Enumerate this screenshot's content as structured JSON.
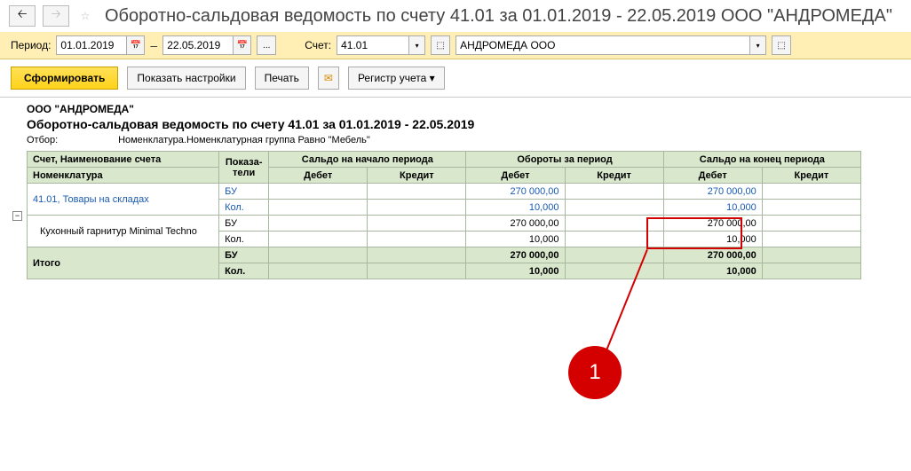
{
  "header": {
    "title": "Оборотно-сальдовая ведомость по счету 41.01 за 01.01.2019 - 22.05.2019 ООО \"АНДРОМЕДА\""
  },
  "filter": {
    "period_label": "Период:",
    "date_from": "01.01.2019",
    "date_to": "22.05.2019",
    "account_label": "Счет:",
    "account": "41.01",
    "org": "АНДРОМЕДА ООО",
    "more": "..."
  },
  "toolbar": {
    "generate": "Сформировать",
    "show_settings": "Показать настройки",
    "print": "Печать",
    "register": "Регистр учета"
  },
  "report": {
    "org_name": "ООО \"АНДРОМЕДА\"",
    "title": "Оборотно-сальдовая ведомость по счету 41.01 за 01.01.2019 - 22.05.2019",
    "selection_label": "Отбор:",
    "selection_value": "Номенклатура.Номенклатурная группа Равно \"Мебель\""
  },
  "grid": {
    "h_account": "Счет, Наименование счета",
    "h_nomen": "Номенклатура",
    "h_indicators": "Показа-\nтели",
    "h_start": "Сальдо на начало периода",
    "h_turn": "Обороты за период",
    "h_end": "Сальдо на конец периода",
    "h_debit": "Дебет",
    "h_credit": "Кредит",
    "row1_name": "41.01, Товары на складах",
    "row1_ind1": "БУ",
    "row1_ind2": "Кол.",
    "row1_turn_d1": "270 000,00",
    "row1_turn_d2": "10,000",
    "row1_end_d1": "270 000,00",
    "row1_end_d2": "10,000",
    "row2_name": "Кухонный гарнитур Minimal Techno",
    "row2_ind1": "БУ",
    "row2_ind2": "Кол.",
    "row2_turn_d1": "270 000,00",
    "row2_turn_d2": "10,000",
    "row2_end_d1": "270 000,00",
    "row2_end_d2": "10,000",
    "total": "Итого",
    "total_ind1": "БУ",
    "total_ind2": "Кол.",
    "total_turn_d1": "270 000,00",
    "total_turn_d2": "10,000",
    "total_end_d1": "270 000,00",
    "total_end_d2": "10,000"
  },
  "callout": {
    "num": "1"
  }
}
